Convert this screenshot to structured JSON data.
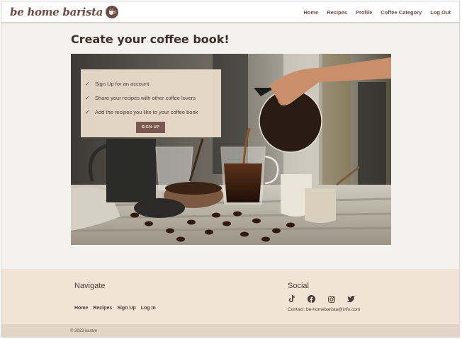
{
  "colors": {
    "brand": "#6e4b44",
    "page_bg": "#f4f2ef",
    "footer_bg": "#f1e4d6",
    "copyright_bg": "#e2d5c8",
    "button_bg": "#7a5750"
  },
  "navbar": {
    "brand": "be home barista",
    "brand_icon": "coffee-cup-icon",
    "links": [
      "Home",
      "Recipes",
      "Profile",
      "Coffee Category",
      "Log Out"
    ]
  },
  "main": {
    "title": "Create your coffee book!",
    "hero_image": "coffee-brewing-photo",
    "card": {
      "items": [
        "Sign Up for an account",
        "Share your recipes with other coffee lovers",
        "Add the recipes you like to your coffee book"
      ],
      "item_icon": "check-icon",
      "button": "SIGN UP"
    }
  },
  "footer": {
    "navigate_heading": "Navigate",
    "navigate_links": [
      "Home",
      "Recipes",
      "Sign Up",
      "Log In"
    ],
    "social_heading": "Social",
    "social_icons": [
      "tiktok-icon",
      "facebook-icon",
      "instagram-icon",
      "twitter-icon"
    ],
    "contact": "Contact: be-homebarista@info.com",
    "copyright": "© 2023 karare"
  }
}
